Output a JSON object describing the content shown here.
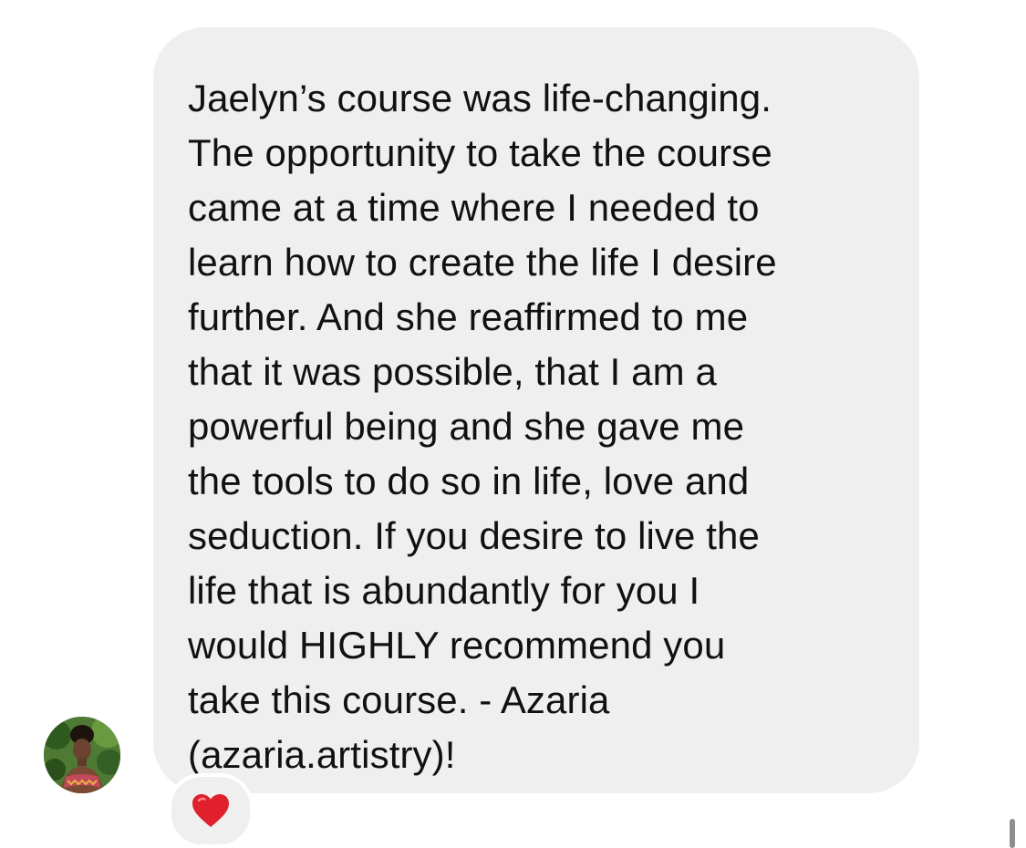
{
  "message": {
    "lines": [
      "Jaelyn’s course was life-changing.",
      "The opportunity to take the course",
      "came at a time where I needed to",
      "learn how to create the life I desire",
      "further. And she reaffirmed to me",
      "that it was possible, that I am a",
      "powerful being and she gave me",
      "the tools to do so in life, love and",
      "seduction. If you desire to live the",
      "life that is abundantly for you I",
      "would HIGHLY recommend you",
      "take this course.  - Azaria",
      "(azaria.artistry)!"
    ]
  },
  "sender": {
    "avatar_icon": "profile-photo"
  },
  "reaction": {
    "icon": "red-heart-icon",
    "color": "#e0202a"
  },
  "colors": {
    "bubble": "#efefef",
    "text": "#111111",
    "background": "#ffffff"
  }
}
